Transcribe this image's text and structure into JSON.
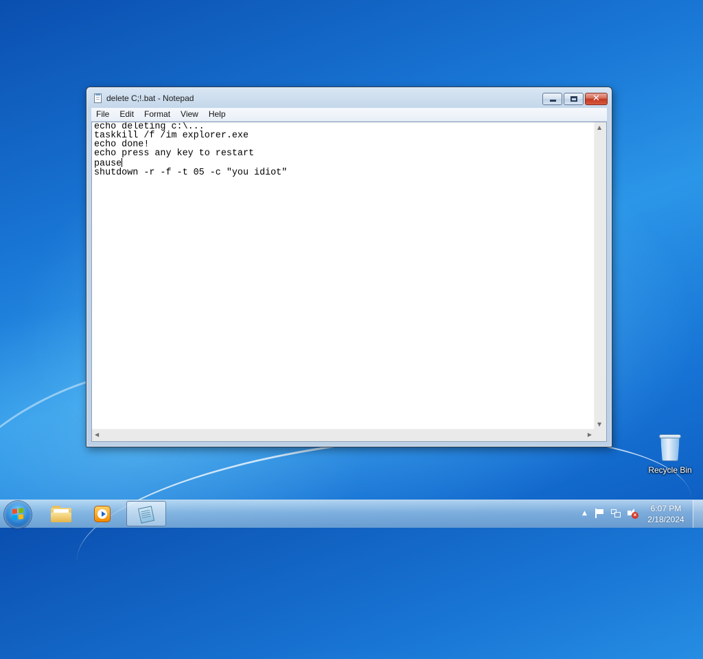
{
  "window": {
    "title": "delete C;!.bat - Notepad",
    "close_glyph": "✕",
    "menu": [
      "File",
      "Edit",
      "Format",
      "View",
      "Help"
    ]
  },
  "editor": {
    "lines_before_caret": "echo deleting c:\\...\ntaskkill /f /im explorer.exe\necho done!\necho press any key to restart\npause",
    "lines_after_caret": "\nshutdown -r -f -t 05 -c \"you idiot\""
  },
  "desktop": {
    "recycle_bin_label": "Recycle Bin"
  },
  "taskbar": {
    "time": "6:07 PM",
    "date": "2/18/2024",
    "tray_chevron": "▲",
    "volume_badge": "×"
  },
  "colors": {
    "desktop_blue": "#1a78d6",
    "close_red": "#c4381e",
    "flag_red": "#f25022",
    "flag_green": "#7fba00",
    "flag_blue": "#00a4ef",
    "flag_yellow": "#ffb900"
  },
  "icons": [
    "start-orb-icon",
    "folder-icon",
    "media-player-icon",
    "notepad-icon",
    "recycle-bin-icon",
    "action-center-flag-icon",
    "network-icon",
    "volume-muted-icon"
  ]
}
